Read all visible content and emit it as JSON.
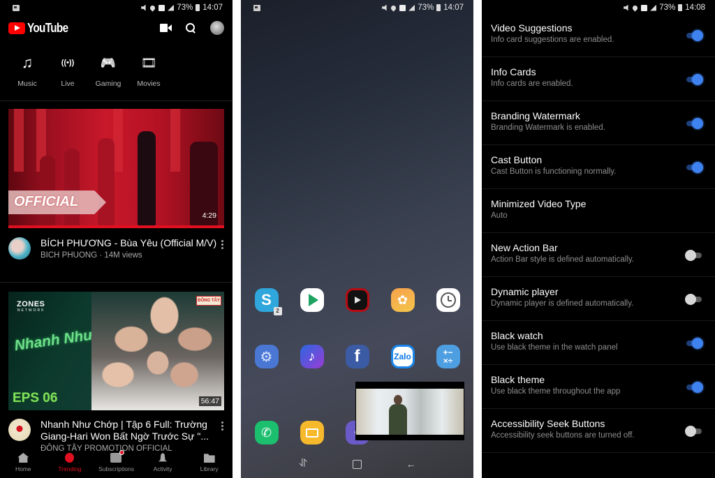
{
  "youtube_panel": {
    "status_bar": {
      "battery": "73%",
      "time": "14:07"
    },
    "header": {
      "logo_text": "YouTube",
      "icons": [
        "camera-icon",
        "search-icon",
        "avatar"
      ]
    },
    "categories": [
      {
        "label": "Music",
        "icon": "music-note-icon",
        "glyph": "♫"
      },
      {
        "label": "Live",
        "icon": "live-broadcast-icon",
        "glyph": "((•))"
      },
      {
        "label": "Gaming",
        "icon": "gamepad-icon",
        "glyph": "🎮"
      },
      {
        "label": "Movies",
        "icon": "film-icon",
        "glyph": "🎞"
      }
    ],
    "videos": [
      {
        "thumbnail_overlay": "OFFICIAL",
        "duration": "4:29",
        "title": "BÍCH PHƯƠNG - Bùa Yêu (Official M/V)",
        "channel_line": "BICH PHUONG · 14M views"
      },
      {
        "thumbnail_brand": "ZONES",
        "thumbnail_brand_sub": "NETWORK",
        "thumbnail_show": "Nhanh Như Chớp",
        "thumbnail_episode": "EPS 06",
        "thumbnail_badge": "ĐÔNG TÂY",
        "duration": "56:47",
        "title": "Nhanh Như Chớp | Tập 6 Full: Trường Giang-Hari Won Bất Ngờ Trước Sự \"...",
        "channel_line": "ĐÔNG TÂY PROMOTION OFFICIAL"
      }
    ],
    "bottom_nav": [
      {
        "label": "Home",
        "icon": "home-icon",
        "active": false
      },
      {
        "label": "Trending",
        "icon": "trending-flame-icon",
        "active": true
      },
      {
        "label": "Subscriptions",
        "icon": "subscriptions-icon",
        "active": false,
        "has_notification_dot": true
      },
      {
        "label": "Activity",
        "icon": "bell-icon",
        "active": false
      },
      {
        "label": "Library",
        "icon": "folder-icon",
        "active": false
      }
    ],
    "accent_color": "#e01020"
  },
  "home_panel": {
    "status_bar": {
      "battery": "73%",
      "time": "14:07"
    },
    "app_rows": [
      [
        {
          "name": "Skype",
          "glyph": "S",
          "badge": "2"
        },
        {
          "name": "Play Store"
        },
        {
          "name": "YouTube Vanced"
        },
        {
          "name": "Gallery",
          "glyph": "✿"
        },
        {
          "name": "Clock"
        }
      ],
      [
        {
          "name": "Settings",
          "glyph": "⚙"
        },
        {
          "name": "Samsung Music",
          "glyph": "♪"
        },
        {
          "name": "Facebook",
          "glyph": "f"
        },
        {
          "name": "Zalo",
          "glyph": "Zalo"
        },
        {
          "name": "Calculator",
          "glyph": "+−\n×÷"
        }
      ],
      [
        {
          "name": "Phone",
          "glyph": "✆"
        },
        {
          "name": "Messages"
        },
        {
          "name": "Viber",
          "glyph": "◐"
        }
      ]
    ],
    "mini_player": {
      "state": "playing"
    },
    "system_nav": [
      "recents-icon",
      "home-button-icon",
      "back-arrow-icon"
    ]
  },
  "settings_panel": {
    "status_bar": {
      "battery": "73%",
      "time": "14:08"
    },
    "items": [
      {
        "title": "Video Suggestions",
        "subtitle": "Info card suggestions are enabled.",
        "enabled": true
      },
      {
        "title": "Info Cards",
        "subtitle": "Info cards are enabled.",
        "enabled": true
      },
      {
        "title": "Branding Watermark",
        "subtitle": "Branding Watermark is enabled.",
        "enabled": true
      },
      {
        "title": "Cast Button",
        "subtitle": "Cast Button is functioning normally.",
        "enabled": true
      },
      {
        "title": "Minimized Video Type",
        "subtitle": "Auto",
        "enabled": null
      },
      {
        "title": "New Action Bar",
        "subtitle": "Action Bar style is defined automatically.",
        "enabled": false
      },
      {
        "title": "Dynamic player",
        "subtitle": "Dynamic player is defined automatically.",
        "enabled": false
      },
      {
        "title": "Black watch",
        "subtitle": "Use black theme in the watch panel",
        "enabled": true
      },
      {
        "title": "Black theme",
        "subtitle": "Use black theme throughout the app",
        "enabled": true
      },
      {
        "title": "Accessibility Seek Buttons",
        "subtitle": "Accessibility seek buttons are turned off.",
        "enabled": false
      }
    ],
    "accent_color": "#3e82f0"
  }
}
